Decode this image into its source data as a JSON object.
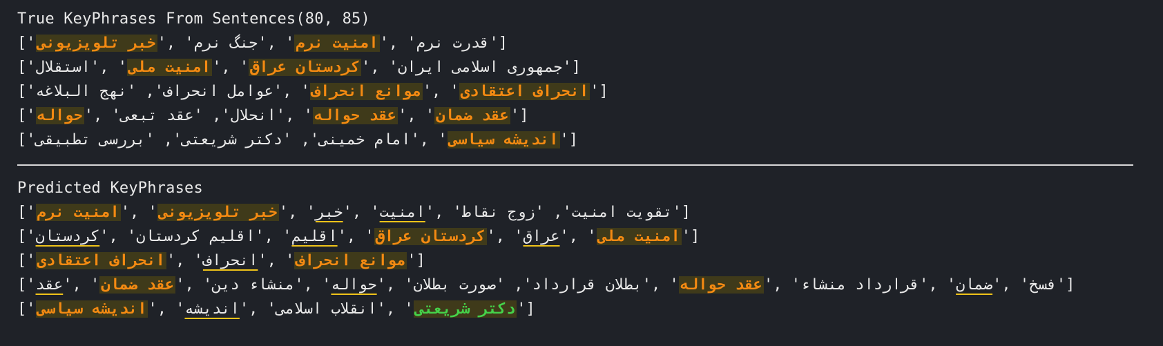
{
  "true_section": {
    "title": "True KeyPhrases From Sentences(80, 85)",
    "rows": [
      [
        {
          "t": "['"
        },
        {
          "t": "خبر تلویزیونی",
          "hl": true
        },
        {
          "t": "', 'جنگ نرم', '"
        },
        {
          "t": "امنیت نرم",
          "hl": true
        },
        {
          "t": "', 'قدرت نرم']"
        }
      ],
      [
        {
          "t": "['استقلال', '"
        },
        {
          "t": "امنیت ملی",
          "hl": true
        },
        {
          "t": "', '"
        },
        {
          "t": "کردستان عراق",
          "hl": true
        },
        {
          "t": "', 'جمهوری اسلامی ایران']"
        }
      ],
      [
        {
          "t": "['عوامل انحراف', 'نهج البلاغه', '"
        },
        {
          "t": "موانع انحراف",
          "hl": true
        },
        {
          "t": "', '"
        },
        {
          "t": "انحراف اعتقادی",
          "hl": true
        },
        {
          "t": "']"
        }
      ],
      [
        {
          "t": "['"
        },
        {
          "t": "حواله",
          "hl": true
        },
        {
          "t": "', 'انحلال', 'عقد تبعی', '"
        },
        {
          "t": "عقد حواله",
          "hl": true
        },
        {
          "t": "', '"
        },
        {
          "t": "عقد ضمان",
          "hl": true
        },
        {
          "t": "']"
        }
      ],
      [
        {
          "t": "['امام خمینی', 'دکتر شریعتی', 'بررسی تطبیقی', '"
        },
        {
          "t": "اندیشه سیاسی",
          "hl": true
        },
        {
          "t": "']"
        }
      ]
    ]
  },
  "pred_section": {
    "title": "Predicted KeyPhrases",
    "rows": [
      [
        {
          "t": "['"
        },
        {
          "t": "امنیت نرم",
          "hl": true
        },
        {
          "t": "', '"
        },
        {
          "t": "خبر تلویزیونی",
          "hl": true
        },
        {
          "t": "', '"
        },
        {
          "t": "خبر",
          "ul": true
        },
        {
          "t": "', '"
        },
        {
          "t": "امنیت",
          "ul": true
        },
        {
          "t": "', 'تقویت امنیت', 'زوج نقاط']"
        }
      ],
      [
        {
          "t": "['"
        },
        {
          "t": "کردستان",
          "ul": true
        },
        {
          "t": "', 'اقلیم کردستان', '"
        },
        {
          "t": "اقلیم",
          "ul": true
        },
        {
          "t": "', '"
        },
        {
          "t": "کردستان عراق",
          "hl": true
        },
        {
          "t": "', '"
        },
        {
          "t": "عراق",
          "ul": true
        },
        {
          "t": "', '"
        },
        {
          "t": "امنیت ملی",
          "hl": true
        },
        {
          "t": "']"
        }
      ],
      [
        {
          "t": "['"
        },
        {
          "t": "انحراف اعتقادی",
          "hl": true
        },
        {
          "t": "', '"
        },
        {
          "t": "انحراف",
          "ul": true
        },
        {
          "t": "', '"
        },
        {
          "t": "موانع انحراف",
          "hl": true
        },
        {
          "t": "']"
        }
      ],
      [
        {
          "t": "['"
        },
        {
          "t": "عقد",
          "ul": true
        },
        {
          "t": "', '"
        },
        {
          "t": "عقد ضمان",
          "hl": true
        },
        {
          "t": "', 'منشاء دین', '"
        },
        {
          "t": "حواله",
          "ul": true
        },
        {
          "t": "', 'بطلان قرارداد', 'صورت بطلان', '"
        },
        {
          "t": "عقد حواله",
          "hl": true
        },
        {
          "t": "', 'قرارداد منشاء', '"
        },
        {
          "t": "ضمان",
          "ul": true
        },
        {
          "t": "', 'فسخ']"
        }
      ],
      [
        {
          "t": "['"
        },
        {
          "t": "اندیشه سیاسی",
          "hl": true
        },
        {
          "t": "', '"
        },
        {
          "t": "اندیشه",
          "ul": true
        },
        {
          "t": "', 'انقلاب اسلامی', '"
        },
        {
          "t": "دکتر شریعتی",
          "hl": true,
          "green": true
        },
        {
          "t": "']"
        }
      ]
    ]
  },
  "colors": {
    "background": "#1f2228",
    "text": "#e9e9e9",
    "highlight_bg": "#3f3a1a",
    "highlight_text": "#f48a12",
    "highlight_green": "#45d24a",
    "underline": "#f0c419"
  }
}
